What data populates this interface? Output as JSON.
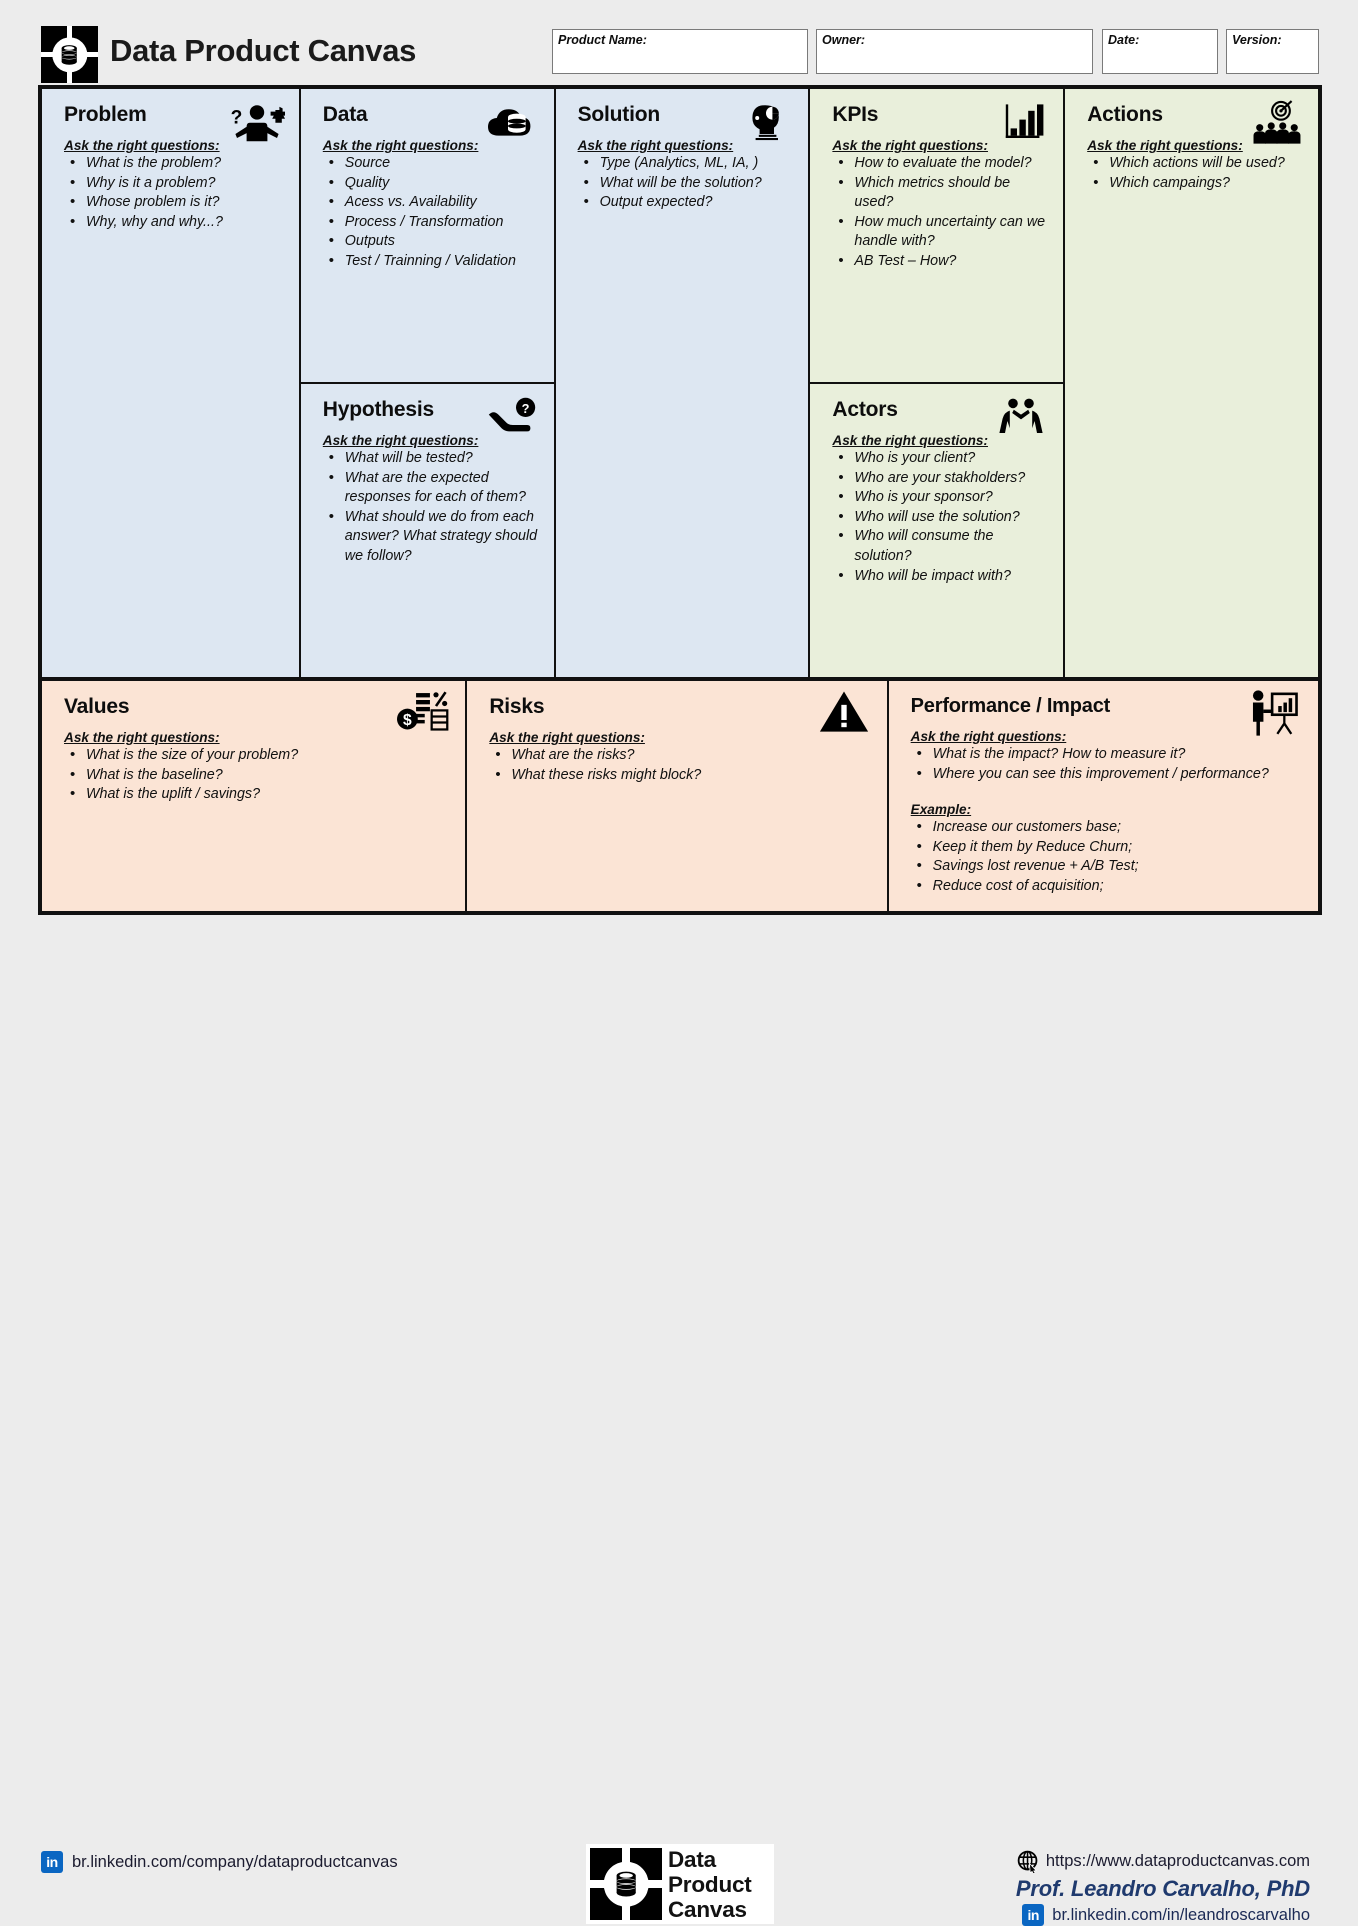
{
  "header": {
    "logo_icon": "data-product-canvas-logo-icon",
    "title": "Data Product Canvas",
    "fields": [
      {
        "name": "product-name",
        "label": "Product Name:",
        "value": "",
        "placeholder": ""
      },
      {
        "name": "owner",
        "label": "Owner:",
        "value": "",
        "placeholder": ""
      },
      {
        "name": "date",
        "label": "Date:",
        "value": "",
        "placeholder": ""
      },
      {
        "name": "version",
        "label": "Version:",
        "value": "",
        "placeholder": ""
      }
    ]
  },
  "panels": {
    "problem": {
      "title": "Problem",
      "icon": "person-shrug-question-puzzle-icon",
      "color": "#dde7f2",
      "ask_label": "Ask the right questions:",
      "questions": [
        "What is the problem?",
        "Why is it a problem?",
        "Whose problem is it?",
        "Why, why and why...?"
      ]
    },
    "data": {
      "title": "Data",
      "icon": "cloud-database-icon",
      "color": "#dde7f2",
      "ask_label": "Ask the right questions:",
      "questions": [
        "Source",
        "Quality",
        "Acess vs. Availability",
        "Process / Transformation",
        "Outputs",
        "Test / Trainning / Validation"
      ]
    },
    "hypothesis": {
      "title": "Hypothesis",
      "icon": "hand-question-mark-icon",
      "color": "#dde7f2",
      "ask_label": "Ask the right questions:",
      "questions": [
        "What will be tested?",
        "What are the expected responses for each of them?",
        "What should we do from each answer? What strategy should we follow?"
      ]
    },
    "solution": {
      "title": "Solution",
      "icon": "head-profile-chart-icon",
      "color": "#dde7f2",
      "ask_label": "Ask the right questions:",
      "questions": [
        "Type (Analytics, ML, IA, )",
        "What will be the solution?",
        "Output expected?"
      ]
    },
    "kpis": {
      "title": "KPIs",
      "icon": "bar-chart-icon",
      "color": "#e9efdb",
      "ask_label": "Ask the right questions:",
      "questions": [
        "How to evaluate the model?",
        "Which metrics should be used?",
        "How much uncertainty can we handle with?",
        "AB Test – How?"
      ]
    },
    "actors": {
      "title": "Actors",
      "icon": "two-people-handshake-icon",
      "color": "#e9efdb",
      "ask_label": "Ask the right questions:",
      "questions": [
        "Who is your client?",
        "Who are your stakholders?",
        "Who is your sponsor?",
        "Who will use the solution?",
        "Who will consume the solution?",
        "Who will be impact with?"
      ]
    },
    "actions": {
      "title": "Actions",
      "icon": "target-audience-icon",
      "color": "#e9efdb",
      "ask_label": "Ask the right questions:",
      "questions": [
        "Which actions will be used?",
        "Which campaings?"
      ]
    },
    "values": {
      "title": "Values",
      "icon": "money-percent-icon",
      "color": "#fbe4d5",
      "ask_label": "Ask the right questions:",
      "questions": [
        "What is the size of your problem?",
        "What is the baseline?",
        "What is the uplift / savings?"
      ]
    },
    "risks": {
      "title": "Risks",
      "icon": "warning-triangle-icon",
      "color": "#fbe4d5",
      "ask_label": "Ask the right questions:",
      "questions": [
        "What are the risks?",
        "What these risks might block?"
      ]
    },
    "performance": {
      "title": "Performance / Impact",
      "icon": "presenter-chart-icon",
      "color": "#fbe4d5",
      "ask_label": "Ask the right questions:",
      "questions": [
        "What is the impact? How to measure it?",
        "Where you can see this improvement / performance?"
      ],
      "example_label": "Example:",
      "examples": [
        "Increase our customers base;",
        "Keep it them by Reduce Churn;",
        "Savings lost revenue + A/B Test;",
        "Reduce cost of acquisition;"
      ]
    }
  },
  "footer": {
    "company_linkedin": "br.linkedin.com/company/dataproductcanvas",
    "logo_words_line1": "Data",
    "logo_words_line2": "Product",
    "logo_words_line3": "Canvas",
    "website": "https://www.dataproductcanvas.com",
    "author": "Prof. Leandro Carvalho, PhD",
    "author_linkedin": "br.linkedin.com/in/leandroscarvalho",
    "linkedin_color": "#0a66c2",
    "author_color": "#1f3a6e"
  }
}
